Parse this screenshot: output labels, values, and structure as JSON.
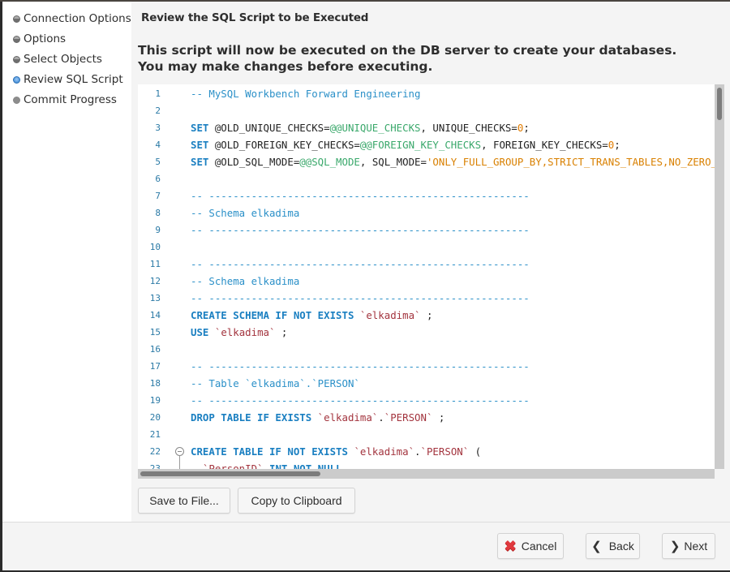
{
  "sidebar": {
    "items": [
      {
        "label": "Connection Options",
        "state": "done"
      },
      {
        "label": "Options",
        "state": "done"
      },
      {
        "label": "Select Objects",
        "state": "done"
      },
      {
        "label": "Review SQL Script",
        "state": "active"
      },
      {
        "label": "Commit Progress",
        "state": "pending"
      }
    ]
  },
  "main": {
    "section_title": "Review the SQL Script to be Executed",
    "description_line1": "This script will now be executed on the DB server to create your databases.",
    "description_line2": "You may make changes before executing."
  },
  "editor": {
    "lines": [
      {
        "n": "1",
        "tokens": [
          [
            "cm",
            "-- MySQL Workbench Forward Engineering"
          ]
        ]
      },
      {
        "n": "2",
        "tokens": []
      },
      {
        "n": "3",
        "tokens": [
          [
            "kw",
            "SET"
          ],
          [
            "",
            " @OLD_UNIQUE_CHECKS="
          ],
          [
            "sv",
            "@@UNIQUE_CHECKS"
          ],
          [
            "",
            ", UNIQUE_CHECKS="
          ],
          [
            "num",
            "0"
          ],
          [
            "",
            ";"
          ]
        ]
      },
      {
        "n": "4",
        "tokens": [
          [
            "kw",
            "SET"
          ],
          [
            "",
            " @OLD_FOREIGN_KEY_CHECKS="
          ],
          [
            "sv",
            "@@FOREIGN_KEY_CHECKS"
          ],
          [
            "",
            ", FOREIGN_KEY_CHECKS="
          ],
          [
            "num",
            "0"
          ],
          [
            "",
            ";"
          ]
        ]
      },
      {
        "n": "5",
        "tokens": [
          [
            "kw",
            "SET"
          ],
          [
            "",
            " @OLD_SQL_MODE="
          ],
          [
            "sv",
            "@@SQL_MODE"
          ],
          [
            "",
            ", SQL_MODE="
          ],
          [
            "str",
            "'ONLY_FULL_GROUP_BY,STRICT_TRANS_TABLES,NO_ZERO_IN_DATE,NO_ZERO_DATE,ERROR_FOR_DIVISION_BY_ZERO,NO_ENGINE_SUBSTITUTION'"
          ],
          [
            "",
            ";"
          ]
        ]
      },
      {
        "n": "6",
        "tokens": []
      },
      {
        "n": "7",
        "tokens": [
          [
            "cm",
            "-- -----------------------------------------------------"
          ]
        ]
      },
      {
        "n": "8",
        "tokens": [
          [
            "cm",
            "-- Schema elkadima"
          ]
        ]
      },
      {
        "n": "9",
        "tokens": [
          [
            "cm",
            "-- -----------------------------------------------------"
          ]
        ]
      },
      {
        "n": "10",
        "tokens": []
      },
      {
        "n": "11",
        "tokens": [
          [
            "cm",
            "-- -----------------------------------------------------"
          ]
        ]
      },
      {
        "n": "12",
        "tokens": [
          [
            "cm",
            "-- Schema elkadima"
          ]
        ]
      },
      {
        "n": "13",
        "tokens": [
          [
            "cm",
            "-- -----------------------------------------------------"
          ]
        ]
      },
      {
        "n": "14",
        "tokens": [
          [
            "kw",
            "CREATE SCHEMA IF NOT EXISTS"
          ],
          [
            "",
            " "
          ],
          [
            "bt",
            "`elkadima`"
          ],
          [
            "",
            " ;"
          ]
        ]
      },
      {
        "n": "15",
        "tokens": [
          [
            "kw",
            "USE"
          ],
          [
            "",
            " "
          ],
          [
            "bt",
            "`elkadima`"
          ],
          [
            "",
            " ;"
          ]
        ]
      },
      {
        "n": "16",
        "tokens": []
      },
      {
        "n": "17",
        "tokens": [
          [
            "cm",
            "-- -----------------------------------------------------"
          ]
        ]
      },
      {
        "n": "18",
        "tokens": [
          [
            "cm",
            "-- Table `elkadima`.`PERSON`"
          ]
        ]
      },
      {
        "n": "19",
        "tokens": [
          [
            "cm",
            "-- -----------------------------------------------------"
          ]
        ]
      },
      {
        "n": "20",
        "tokens": [
          [
            "kw",
            "DROP TABLE IF EXISTS"
          ],
          [
            "",
            " "
          ],
          [
            "bt",
            "`elkadima`"
          ],
          [
            "",
            "."
          ],
          [
            "bt",
            "`PERSON`"
          ],
          [
            "",
            " ;"
          ]
        ]
      },
      {
        "n": "21",
        "tokens": []
      },
      {
        "n": "22",
        "tokens": [
          [
            "kw",
            "CREATE TABLE IF NOT EXISTS"
          ],
          [
            "",
            " "
          ],
          [
            "bt",
            "`elkadima`"
          ],
          [
            "",
            "."
          ],
          [
            "bt",
            "`PERSON`"
          ],
          [
            "",
            " ("
          ]
        ],
        "fold": true
      },
      {
        "n": "23",
        "tokens": [
          [
            "",
            "  "
          ],
          [
            "bt",
            "`PersonID`"
          ],
          [
            "",
            " "
          ],
          [
            "kw",
            "INT NOT NULL"
          ],
          [
            "",
            ","
          ]
        ]
      }
    ]
  },
  "buttons": {
    "save_to_file": "Save to File...",
    "copy_to_clipboard": "Copy to Clipboard",
    "cancel": "Cancel",
    "back": "Back",
    "next": "Next"
  }
}
